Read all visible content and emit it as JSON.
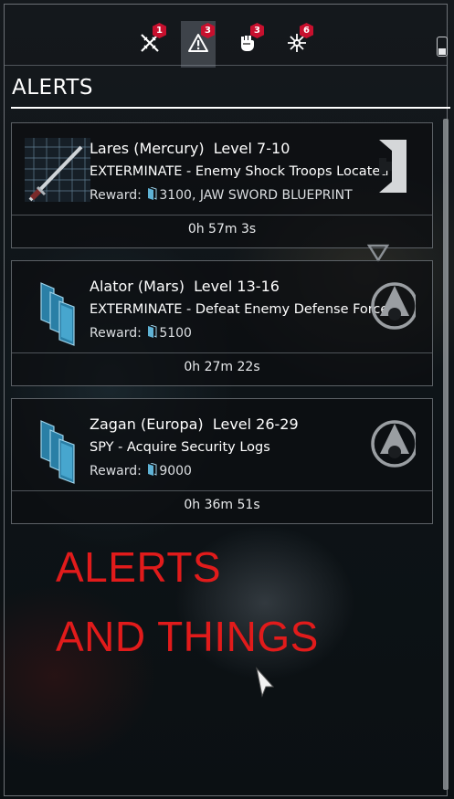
{
  "header": {
    "tabs": [
      {
        "name": "invasions",
        "icon": "crossed-swords-icon",
        "badge": "1",
        "active": false
      },
      {
        "name": "alerts",
        "icon": "warning-icon",
        "badge": "3",
        "active": true
      },
      {
        "name": "syndicates",
        "icon": "fist-icon",
        "badge": "3",
        "active": false
      },
      {
        "name": "sorties",
        "icon": "network-icon",
        "badge": "6",
        "active": false
      }
    ]
  },
  "page": {
    "title": "ALERTS"
  },
  "alerts": [
    {
      "location": "Lares (Mercury)",
      "level": "Level 7-10",
      "mission": "EXTERMINATE - Enemy Shock Troops Located",
      "reward_label": "Reward:",
      "reward_value": "3100, JAW SWORD BLUEPRINT",
      "timer": "0h 57m 3s",
      "faction_icon": "grineer-icon",
      "thumb_icon": "blueprint-sword-icon"
    },
    {
      "location": "Alator (Mars)",
      "level": "Level 13-16",
      "mission": "EXTERMINATE - Defeat Enemy Defense Forces",
      "reward_label": "Reward:",
      "reward_value": "5100",
      "timer": "0h 27m 22s",
      "faction_icon": "corpus-icon",
      "thumb_icon": "credits-cards-icon"
    },
    {
      "location": "Zagan (Europa)",
      "level": "Level 26-29",
      "mission": "SPY - Acquire Security Logs",
      "reward_label": "Reward:",
      "reward_value": "9000",
      "timer": "0h 36m 51s",
      "faction_icon": "corpus-icon",
      "thumb_icon": "credits-cards-icon"
    }
  ],
  "overlay": {
    "line1": "ALERTS",
    "line2": "AND THINGS"
  },
  "colors": {
    "overlay_red": "#e11b1b",
    "badge_red": "#c8102e"
  }
}
